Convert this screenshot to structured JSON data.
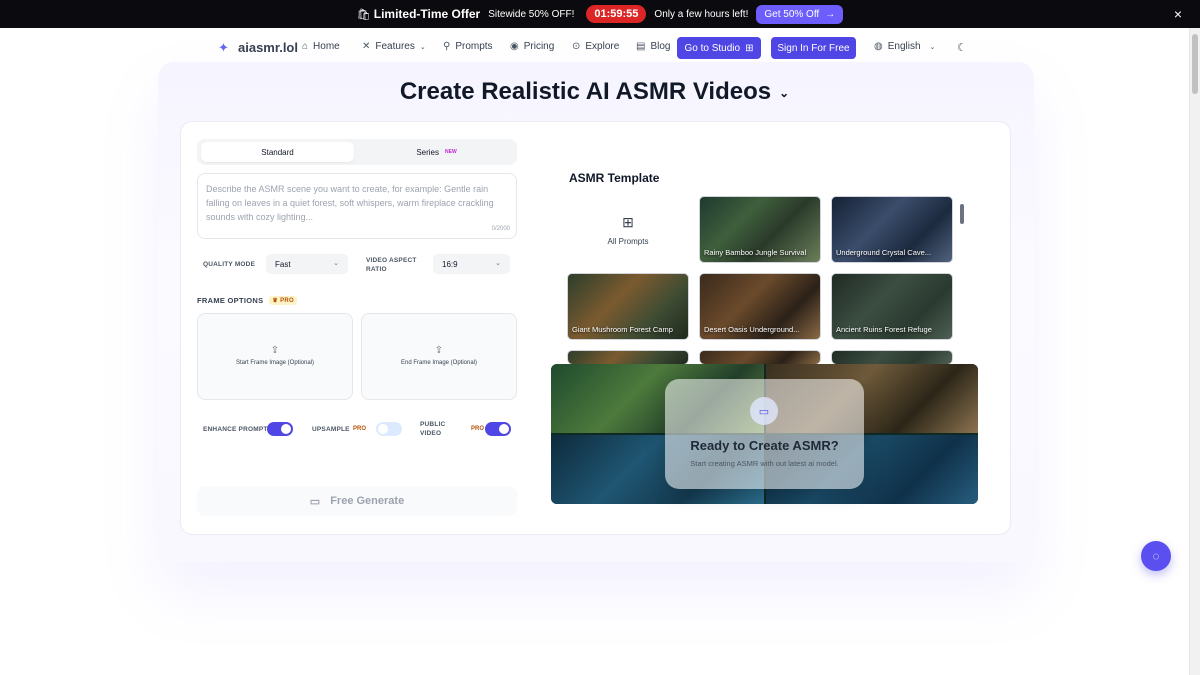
{
  "promo": {
    "title": "Limited-Time Offer",
    "subtitle": "Sitewide 50% OFF!",
    "timer": "01:59:55",
    "few_hours": "Only a few hours left!",
    "cta": "Get 50% Off",
    "close": "×"
  },
  "nav": {
    "brand": "aiasmr.lol",
    "home": "Home",
    "features": "Features",
    "prompts": "Prompts",
    "pricing": "Pricing",
    "explore": "Explore",
    "blog": "Blog",
    "studio": "Go to Studio",
    "signin": "Sign In For Free",
    "language": "English"
  },
  "hero": {
    "title": "Create Realistic AI ASMR Videos"
  },
  "form": {
    "tabs": [
      {
        "label": "Standard",
        "active": true
      },
      {
        "label": "Series",
        "badge": "NEW"
      }
    ],
    "prompt_placeholder": "Describe the ASMR scene you want to create, for example: Gentle rain falling on leaves in a quiet forest, soft whispers, warm fireplace crackling sounds with cozy lighting...",
    "char_count": "0/2000",
    "quality_label": "QUALITY MODE",
    "quality_value": "Fast",
    "aspect_label": "VIDEO ASPECT RATIO",
    "aspect_value": "16:9",
    "frame_options_label": "FRAME OPTIONS",
    "pro_badge": "PRO",
    "start_frame": "Start Frame Image (Optional)",
    "end_frame": "End Frame Image (Optional)",
    "enhance_label": "ENHANCE PROMPT",
    "upsample_label": "UPSAMPLE",
    "public_label": "PUBLIC VIDEO",
    "enhance_on": true,
    "upsample_on": false,
    "public_on": true,
    "generate": "Free Generate"
  },
  "templates": {
    "title": "ASMR Template",
    "all_prompts": "All Prompts",
    "items": [
      {
        "label": "Rainy Bamboo Jungle Survival"
      },
      {
        "label": "Underground Crystal Cave..."
      },
      {
        "label": "Giant Mushroom Forest Camp"
      },
      {
        "label": "Desert Oasis Underground..."
      },
      {
        "label": "Ancient Ruins Forest Refuge"
      }
    ]
  },
  "preview": {
    "heading": "Ready to Create ASMR?",
    "subtext": "Start creating ASMR with out latest ai model."
  },
  "colors": {
    "accent": "#4f46e5",
    "promo_bg": "#0b0b0f",
    "timer": "#dc2626"
  }
}
